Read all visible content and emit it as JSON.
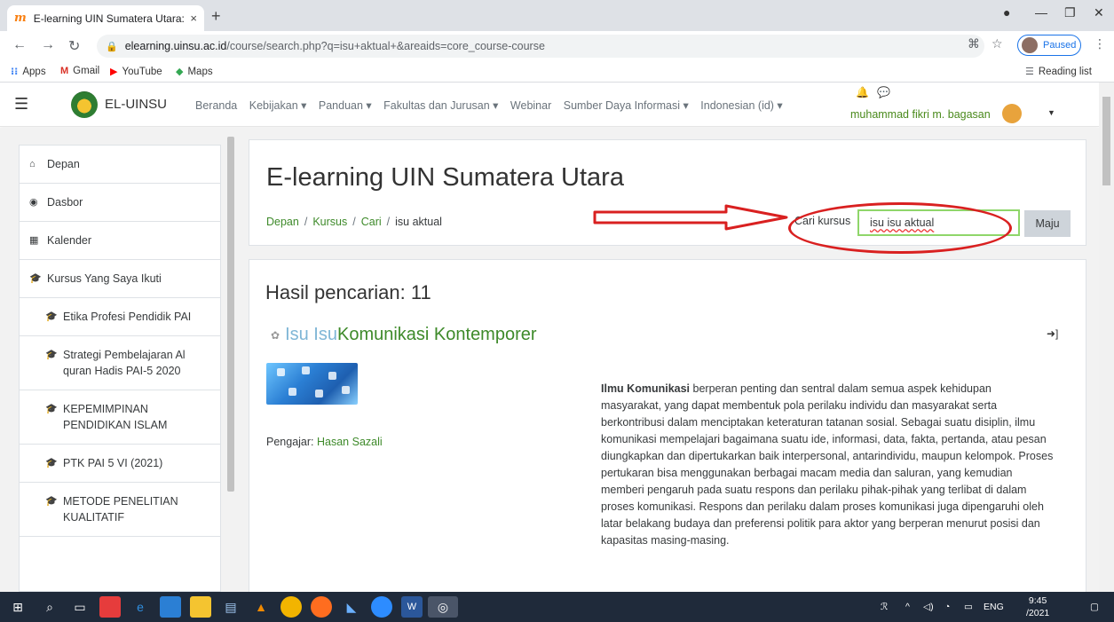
{
  "browser": {
    "tab_title": "E-learning UIN Sumatera Utara: I",
    "tab_close": "×",
    "new_tab": "+",
    "url_host": "elearning.uinsu.ac.id",
    "url_path": "/course/search.php?q=isu+aktual+&areaids=core_course-course",
    "paused_label": "Paused",
    "bookmarks": [
      "Apps",
      "Gmail",
      "YouTube",
      "Maps"
    ],
    "reading_list": "Reading list"
  },
  "navbar": {
    "brand": "EL-UINSU",
    "menu": [
      "Beranda",
      "Kebijakan ▾",
      "Panduan ▾",
      "Fakultas dan Jurusan ▾",
      "Webinar",
      "Sumber Daya Informasi ▾",
      "Indonesian (id) ▾"
    ],
    "user_name": "muhammad fikri m. bagasan"
  },
  "drawer": {
    "items": [
      {
        "icon": "home-icon",
        "label": "Depan"
      },
      {
        "icon": "dashboard-icon",
        "label": "Dasbor"
      },
      {
        "icon": "calendar-icon",
        "label": "Kalender"
      },
      {
        "icon": "graduation-cap-icon",
        "label": "Kursus Yang Saya Ikuti"
      },
      {
        "icon": "graduation-cap-icon",
        "label": "Etika Profesi Pendidik PAI"
      },
      {
        "icon": "graduation-cap-icon",
        "label": "Strategi Pembelajaran Al quran Hadis PAI-5 2020"
      },
      {
        "icon": "graduation-cap-icon",
        "label": "KEPEMIMPINAN PENDIDIKAN ISLAM"
      },
      {
        "icon": "graduation-cap-icon",
        "label": "PTK PAI 5 VI (2021)"
      },
      {
        "icon": "graduation-cap-icon",
        "label": "METODE PENELITIAN KUALITATIF"
      }
    ]
  },
  "header": {
    "title": "E-learning UIN Sumatera Utara",
    "breadcrumb": [
      "Depan",
      "Kursus",
      "Cari",
      "isu aktual"
    ],
    "search_label": "Cari kursus",
    "search_value": "isu isu aktual",
    "search_button": "Maju"
  },
  "results": {
    "title": "Hasil pencarian: 11",
    "course": {
      "name_highlight": "Isu Isu",
      "name_rest": " Komunikasi Kontemporer",
      "teacher_label": "Pengajar:",
      "teacher_name": "Hasan Sazali",
      "summary_bold": "Ilmu Komunikasi",
      "summary_text": " berperan penting dan sentral dalam semua aspek kehidupan masyarakat, yang dapat membentuk pola perilaku individu dan masyarakat serta berkontribusi dalam menciptakan keteraturan tatanan sosial. Sebagai suatu disiplin, ilmu komunikasi mempelajari bagaimana suatu ide, informasi, data, fakta, pertanda, atau pesan diungkapkan dan dipertukarkan baik interpersonal, antarindividu, maupun kelompok. Proses pertukaran bisa menggunakan berbagai macam media dan saluran, yang kemudian memberi pengaruh pada suatu respons dan perilaku pihak-pihak yang terlibat di dalam proses komunikasi. Respons dan perilaku dalam proses komunikasi juga dipengaruhi oleh latar belakang budaya dan preferensi politik para aktor yang berperan menurut posisi dan kapasitas masing-masing."
    }
  },
  "taskbar": {
    "lang": "ENG",
    "time": "9:45",
    "date": "/2021"
  },
  "colors": {
    "accent_green": "#3e8a2a",
    "annotation_red": "#d92020",
    "input_border": "#8fd66a"
  }
}
